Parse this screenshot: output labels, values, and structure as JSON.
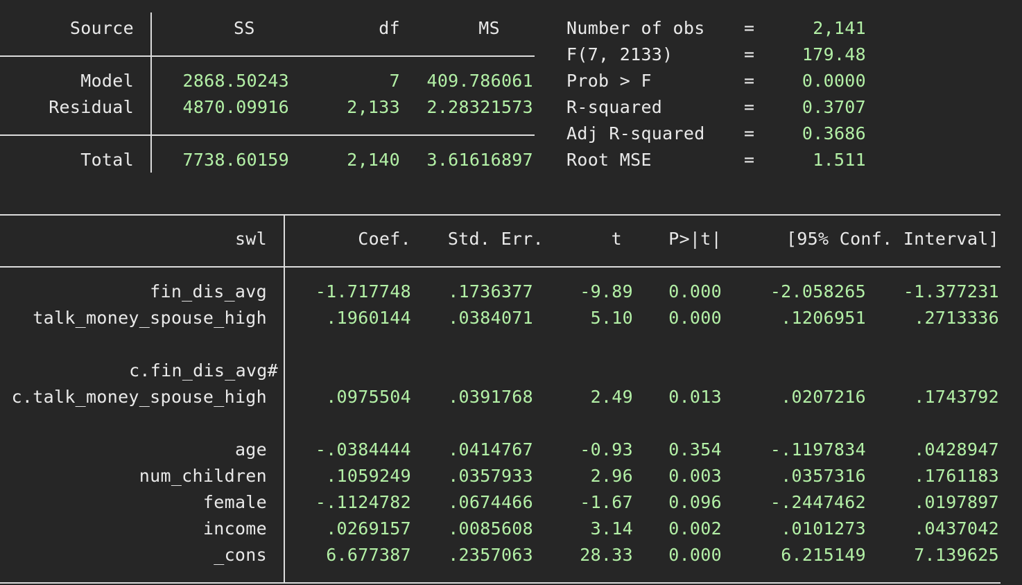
{
  "anova": {
    "headers": {
      "source": "Source",
      "ss": "SS",
      "df": "df",
      "ms": "MS"
    },
    "rows": [
      {
        "source": "Model",
        "ss": "2868.50243",
        "df": "7",
        "ms": "409.786061"
      },
      {
        "source": "Residual",
        "ss": "4870.09916",
        "df": "2,133",
        "ms": "2.28321573"
      },
      {
        "source": "Total",
        "ss": "7738.60159",
        "df": "2,140",
        "ms": "3.61616897"
      }
    ]
  },
  "fit_stats": [
    {
      "label": "Number of obs",
      "eq": "=",
      "value": "2,141"
    },
    {
      "label": "F(7, 2133)",
      "eq": "=",
      "value": "179.48"
    },
    {
      "label": "Prob > F",
      "eq": "=",
      "value": "0.0000"
    },
    {
      "label": "R-squared",
      "eq": "=",
      "value": "0.3707"
    },
    {
      "label": "Adj R-squared",
      "eq": "=",
      "value": "0.3686"
    },
    {
      "label": "Root MSE",
      "eq": "=",
      "value": "1.511"
    }
  ],
  "coef_table": {
    "headers": {
      "var": "swl",
      "coef": "Coef.",
      "se": "Std. Err.",
      "t": "t",
      "p": "P>|t|",
      "ci": "[95% Conf. Interval]"
    },
    "rows": [
      {
        "var": "fin_dis_avg",
        "coef": "-1.717748",
        "se": ".1736377",
        "t": "-9.89",
        "p": "0.000",
        "ci_lo": "-2.058265",
        "ci_hi": "-1.377231"
      },
      {
        "var": "talk_money_spouse_high",
        "coef": ".1960144",
        "se": ".0384071",
        "t": "5.10",
        "p": "0.000",
        "ci_lo": ".1206951",
        "ci_hi": ".2713336"
      },
      {
        "var_line1": "c.fin_dis_avg#",
        "var": "c.talk_money_spouse_high",
        "coef": ".0975504",
        "se": ".0391768",
        "t": "2.49",
        "p": "0.013",
        "ci_lo": ".0207216",
        "ci_hi": ".1743792"
      },
      {
        "var": "age",
        "coef": "-.0384444",
        "se": ".0414767",
        "t": "-0.93",
        "p": "0.354",
        "ci_lo": "-.1197834",
        "ci_hi": ".0428947"
      },
      {
        "var": "num_children",
        "coef": ".1059249",
        "se": ".0357933",
        "t": "2.96",
        "p": "0.003",
        "ci_lo": ".0357316",
        "ci_hi": ".1761183"
      },
      {
        "var": "female",
        "coef": "-.1124782",
        "se": ".0674466",
        "t": "-1.67",
        "p": "0.096",
        "ci_lo": "-.2447462",
        "ci_hi": ".0197897"
      },
      {
        "var": "income",
        "coef": ".0269157",
        "se": ".0085608",
        "t": "3.14",
        "p": "0.002",
        "ci_lo": ".0101273",
        "ci_hi": ".0437042"
      },
      {
        "var": "_cons",
        "coef": "6.677387",
        "se": ".2357063",
        "t": "28.33",
        "p": "0.000",
        "ci_lo": "6.215149",
        "ci_hi": "7.139625"
      }
    ]
  },
  "colors": {
    "background": "#262626",
    "label_text": "#e9e9e9",
    "value_text": "#b3f0a6",
    "rule": "#dcdcdc"
  }
}
